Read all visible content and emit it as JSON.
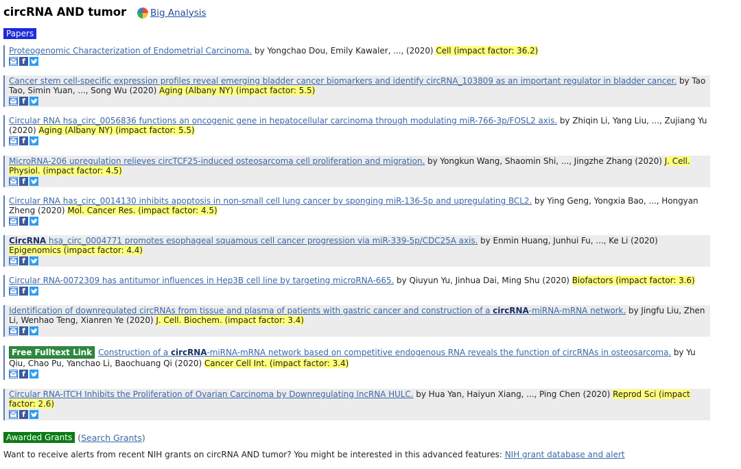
{
  "header": {
    "title": "circRNA AND tumor",
    "big_analysis_label": "Big Analysis"
  },
  "papers_label": "Papers",
  "papers": [
    {
      "title": "Proteogenomic Characterization of Endometrial Carcinoma.",
      "authors": " by Yongchao Dou, Emily Kawaler, ..., (2020) ",
      "journal": "Cell (impact factor: 36.2)"
    },
    {
      "title": "Cancer stem cell-specific expression profiles reveal emerging bladder cancer biomarkers and identify circRNA_103809 as an important regulator in bladder cancer.",
      "authors": " by Tao Tao, Simin Yuan, ..., Song Wu (2020) ",
      "journal": "Aging (Albany NY) (impact factor: 5.5)"
    },
    {
      "title": "Circular RNA hsa_circ_0056836 functions an oncogenic gene in hepatocellular carcinoma through modulating miR-766-3p/FOSL2 axis.",
      "authors": " by Zhiqin Li, Yang Liu, ..., Zujiang Yu (2020) ",
      "journal": "Aging (Albany NY) (impact factor: 5.5)"
    },
    {
      "title": "MicroRNA-206 upregulation relieves circTCF25-induced osteosarcoma cell proliferation and migration.",
      "authors": " by Yongkun Wang, Shaomin Shi, ..., Jingzhe Zhang (2020) ",
      "journal": "J. Cell. Physiol. (impact factor: 4.5)"
    },
    {
      "title": "Circular RNA has_circ_0014130 inhibits apoptosis in non-small cell lung cancer by sponging miR-136-5p and upregulating BCL2.",
      "authors": " by Ying Geng, Yongxia Bao, ..., Hongyan Zheng (2020) ",
      "journal": "Mol. Cancer Res. (impact factor: 4.5)"
    },
    {
      "title_bold": "CircRNA",
      "title": " hsa_circ_0004771 promotes esophageal squamous cell cancer progression via miR-339-5p/CDC25A axis.",
      "authors": " by Enmin Huang, Junhui Fu, ..., Ke Li (2020) ",
      "journal": "Epigenomics (impact factor: 4.4)"
    },
    {
      "title": "Circular RNA-0072309 has antitumor influences in Hep3B cell line by targeting microRNA-665.",
      "authors": " by Qiuyun Yu, Jinhua Dai, Ming Shu (2020) ",
      "journal": "Biofactors (impact factor: 3.6)"
    },
    {
      "title_a": "Identification of downregulated circRNAs from tissue and plasma of patients with gastric cancer and construction of a ",
      "title_bold": "circRNA",
      "title_b": "-miRNA-mRNA network.",
      "authors": " by Jingfu Liu, Zhen Li, Wenhao Teng, Xianren Ye (2020) ",
      "journal": "J. Cell. Biochem. (impact factor: 3.4)"
    },
    {
      "fulltext_label": "Free Fulltext Link",
      "title_a": "Construction of a ",
      "title_bold": "circRNA",
      "title_b": "-miRNA-mRNA network based on competitive endogenous RNA reveals the function of circRNAs in osteosarcoma.",
      "authors": " by Yu Qiu, Chao Pu, Yanchao Li, Baochuang Qi (2020) ",
      "journal": "Cancer Cell Int. (impact factor: 3.4)"
    },
    {
      "title": "Circular RNA-ITCH Inhibits the Proliferation of Ovarian Carcinoma by Downregulating lncRNA HULC.",
      "authors": " by Hua Yan, Haiyun Xiang, ..., Ping Chen (2020) ",
      "journal": "Reprod Sci (impact factor: 2.6)"
    }
  ],
  "share_icons": [
    "mail-icon",
    "facebook-icon",
    "twitter-icon"
  ],
  "grants": {
    "label": "Awarded Grants",
    "open_paren": "(",
    "search_label": "Search Grants",
    "close_paren": ")"
  },
  "alert": {
    "text": "Want to receive alerts from recent NIH grants on circRNA AND tumor? You might be interested in this advanced features: ",
    "link": "NIH grant database and alert"
  },
  "colors": {
    "papers_tag": "#1e2bd8",
    "grants_tag": "#0c7a15",
    "highlight": "#ffff7a",
    "link": "#3a67a8"
  }
}
